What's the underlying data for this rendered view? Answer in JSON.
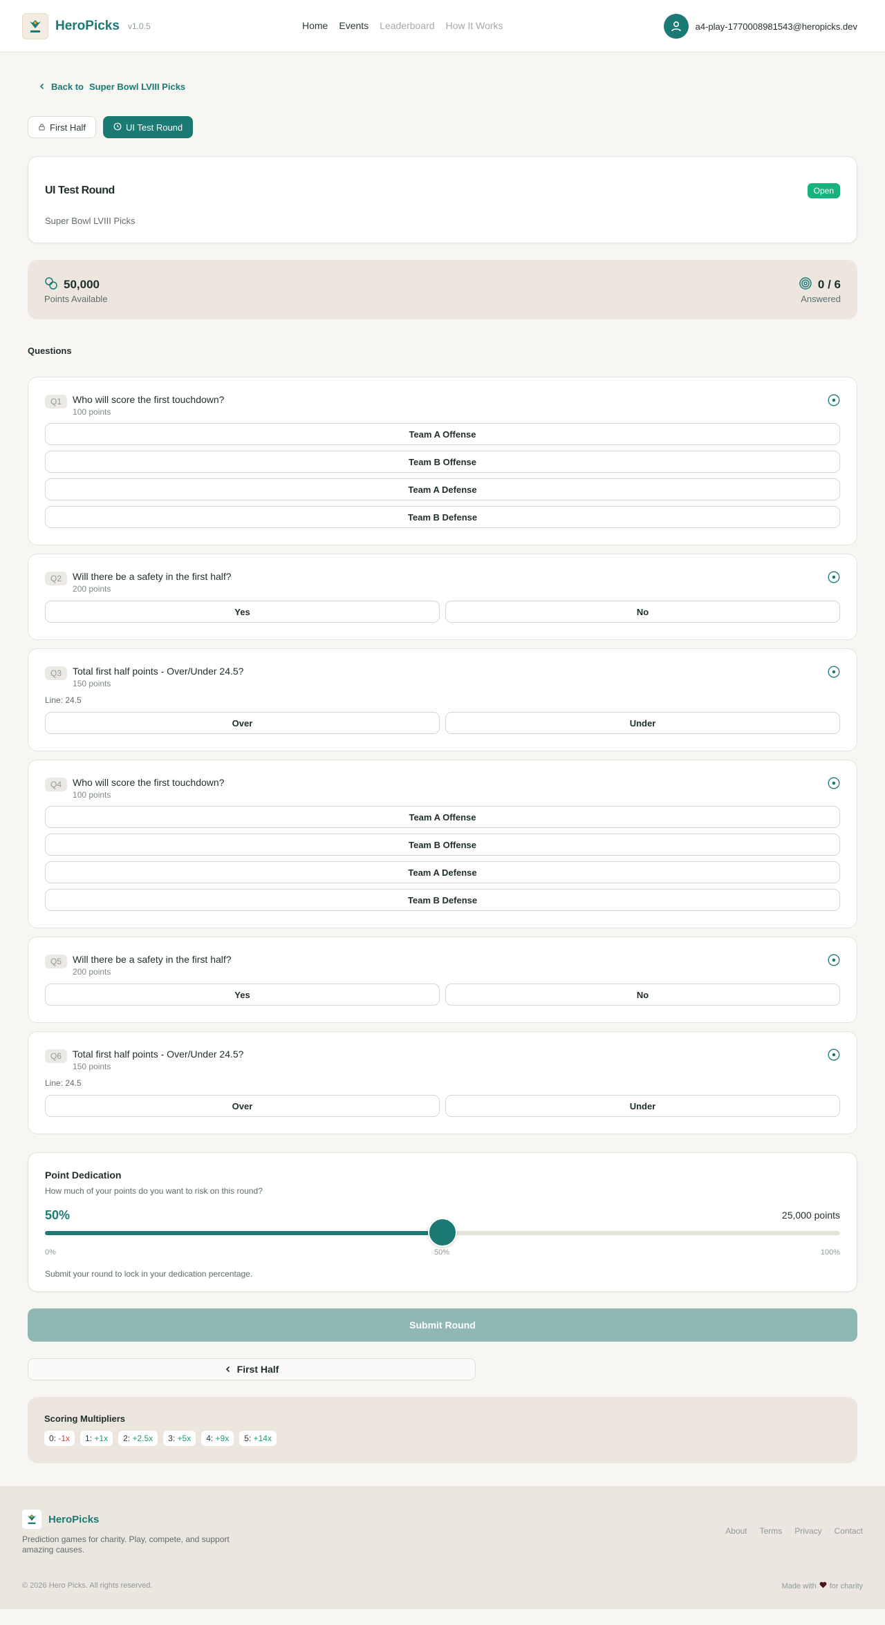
{
  "header": {
    "brand": "HeroPicks",
    "version": "v1.0.5",
    "nav": [
      "Home",
      "Events",
      "Leaderboard",
      "How It Works"
    ],
    "user_email": "a4-play-1770008981543@heropicks.dev"
  },
  "back": {
    "label_prefix": "Back to",
    "label_target": "Super Bowl LVIII Picks"
  },
  "round_tabs": [
    {
      "label": "First Half",
      "state": "locked"
    },
    {
      "label": "UI Test Round",
      "state": "active"
    }
  ],
  "round": {
    "title": "UI Test Round",
    "status": "Open",
    "event": "Super Bowl LVIII Picks"
  },
  "stats": {
    "points_value": "50,000",
    "points_label": "Points Available",
    "answered_value": "0 / 6",
    "answered_label": "Answered"
  },
  "questions_title": "Questions",
  "questions": [
    {
      "num": "Q1",
      "text": "Who will score the first touchdown?",
      "points": "100 points",
      "line": "",
      "layout": "list",
      "options": [
        "Team A Offense",
        "Team B Offense",
        "Team A Defense",
        "Team B Defense"
      ]
    },
    {
      "num": "Q2",
      "text": "Will there be a safety in the first half?",
      "points": "200 points",
      "line": "",
      "layout": "row",
      "options": [
        "Yes",
        "No"
      ]
    },
    {
      "num": "Q3",
      "text": "Total first half points - Over/Under 24.5?",
      "points": "150 points",
      "line": "Line: 24.5",
      "layout": "row",
      "options": [
        "Over",
        "Under"
      ]
    },
    {
      "num": "Q4",
      "text": "Who will score the first touchdown?",
      "points": "100 points",
      "line": "",
      "layout": "list",
      "options": [
        "Team A Offense",
        "Team B Offense",
        "Team A Defense",
        "Team B Defense"
      ]
    },
    {
      "num": "Q5",
      "text": "Will there be a safety in the first half?",
      "points": "200 points",
      "line": "",
      "layout": "row",
      "options": [
        "Yes",
        "No"
      ]
    },
    {
      "num": "Q6",
      "text": "Total first half points - Over/Under 24.5?",
      "points": "150 points",
      "line": "Line: 24.5",
      "layout": "row",
      "options": [
        "Over",
        "Under"
      ]
    }
  ],
  "dedication": {
    "title": "Point Dedication",
    "subtitle": "How much of your points do you want to risk on this round?",
    "percent_label": "50%",
    "percent_value": 0.5,
    "points_label": "25,000 points",
    "tick_min": "0%",
    "tick_mid": "50%",
    "tick_max": "100%",
    "note": "Submit your round to lock in your dedication percentage."
  },
  "submit_label": "Submit Round",
  "prev_round_label": "First Half",
  "multipliers": {
    "title": "Scoring Multipliers",
    "items": [
      {
        "k": "0:",
        "v": "-1x",
        "neg": true
      },
      {
        "k": "1:",
        "v": "+1x",
        "neg": false
      },
      {
        "k": "2:",
        "v": "+2.5x",
        "neg": false
      },
      {
        "k": "3:",
        "v": "+5x",
        "neg": false
      },
      {
        "k": "4:",
        "v": "+9x",
        "neg": false
      },
      {
        "k": "5:",
        "v": "+14x",
        "neg": false
      }
    ]
  },
  "footer": {
    "brand": "HeroPicks",
    "tagline": "Prediction games for charity. Play, compete, and support amazing causes.",
    "links": [
      "About",
      "Terms",
      "Privacy",
      "Contact"
    ],
    "copyright": "© 2026 Hero Picks. All rights reserved.",
    "made_prefix": "Made with",
    "made_suffix": "for charity"
  },
  "colors": {
    "accent": "#1b7a73",
    "success": "#18b27e",
    "danger": "#d94040"
  }
}
